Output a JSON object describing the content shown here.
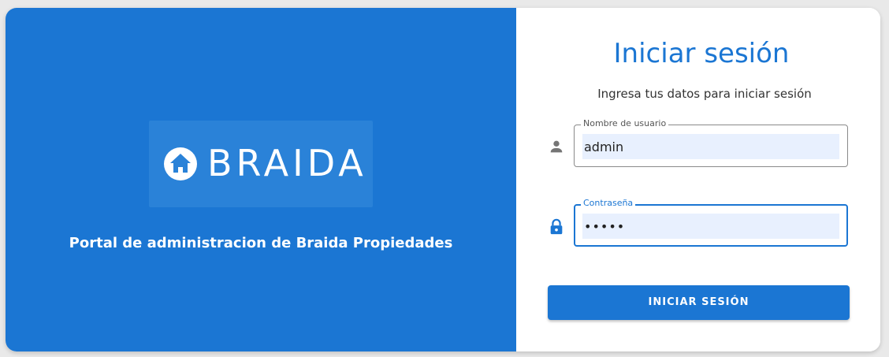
{
  "brand": {
    "name": "BRAIDA",
    "logo_icon": "home-icon",
    "tagline": "Portal de administracion de Braida Propiedades",
    "primary_color": "#1b76d3"
  },
  "login": {
    "title": "Iniciar sesión",
    "subtitle": "Ingresa tus datos para iniciar sesión",
    "username": {
      "label": "Nombre de usuario",
      "value": "admin",
      "icon": "person-icon"
    },
    "password": {
      "label": "Contraseña",
      "value": "•••••",
      "icon": "lock-icon"
    },
    "submit_label": "INICIAR SESIÓN"
  }
}
